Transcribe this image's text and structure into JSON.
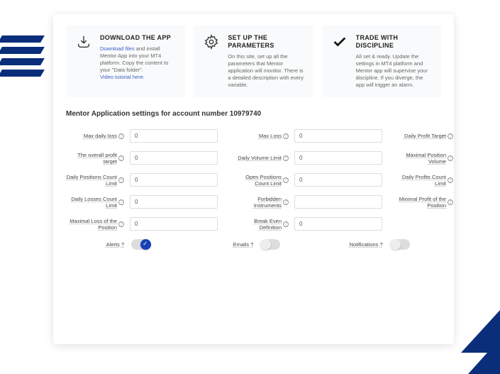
{
  "steps": [
    {
      "title": "DOWNLOAD THE APP",
      "link1": "Download files",
      "text1": " and install Mentor App into your MT4 platform. Copy the content to your \"Data folder\".",
      "link2": "Video tutorial here."
    },
    {
      "title": "SET UP THE PARAMETERS",
      "text": "On this site, set up all the parameters that Mentor application will monitor. There is a detailed description with every variable."
    },
    {
      "title": "TRADE WITH DISCIPLINE",
      "text": "All set & ready. Update the settings in MT4 platform and Mentor app will supervise your discipline. If you diverge, the app will trigger an alarm."
    }
  ],
  "sectionTitle": "Mentor Application settings for account number 10979740",
  "fields": {
    "maxDailyLoss": {
      "label": "Max daily loss",
      "value": "0"
    },
    "maxLoss": {
      "label": "Max Loss",
      "value": "0"
    },
    "dailyProfitTarget": {
      "label": "Daily Profit Target",
      "value": "0"
    },
    "overallProfit": {
      "label": "The overall profit target",
      "value": "0"
    },
    "dailyVolumeLimit": {
      "label": "Daily Volume Limit",
      "value": "0"
    },
    "maxPositionVolume": {
      "label": "Maximal Position Volume",
      "value": "0"
    },
    "dailyPosCount": {
      "label": "Daily Positions Count Limit",
      "value": "0"
    },
    "openPosCount": {
      "label": "Open Positions Count Limit",
      "value": "0"
    },
    "dailyProfitsCount": {
      "label": "Daily Profits Count Limit",
      "value": "0"
    },
    "dailyLossesCount": {
      "label": "Daily Losses Count Limit",
      "value": "0"
    },
    "forbiddenInstr": {
      "label": "Forbidden Instruments",
      "value": ""
    },
    "minProfitPos": {
      "label": "Minimal Profit of the Position",
      "value": "0"
    },
    "maxLossPos": {
      "label": "Maximal Loss of the Position",
      "value": "0"
    },
    "breakEven": {
      "label": "Break Even Definition",
      "value": "0"
    }
  },
  "toggles": {
    "alerts": {
      "label": "Alerts",
      "on": true
    },
    "emails": {
      "label": "Emails",
      "on": false
    },
    "notifications": {
      "label": "Notifications",
      "on": false
    }
  }
}
